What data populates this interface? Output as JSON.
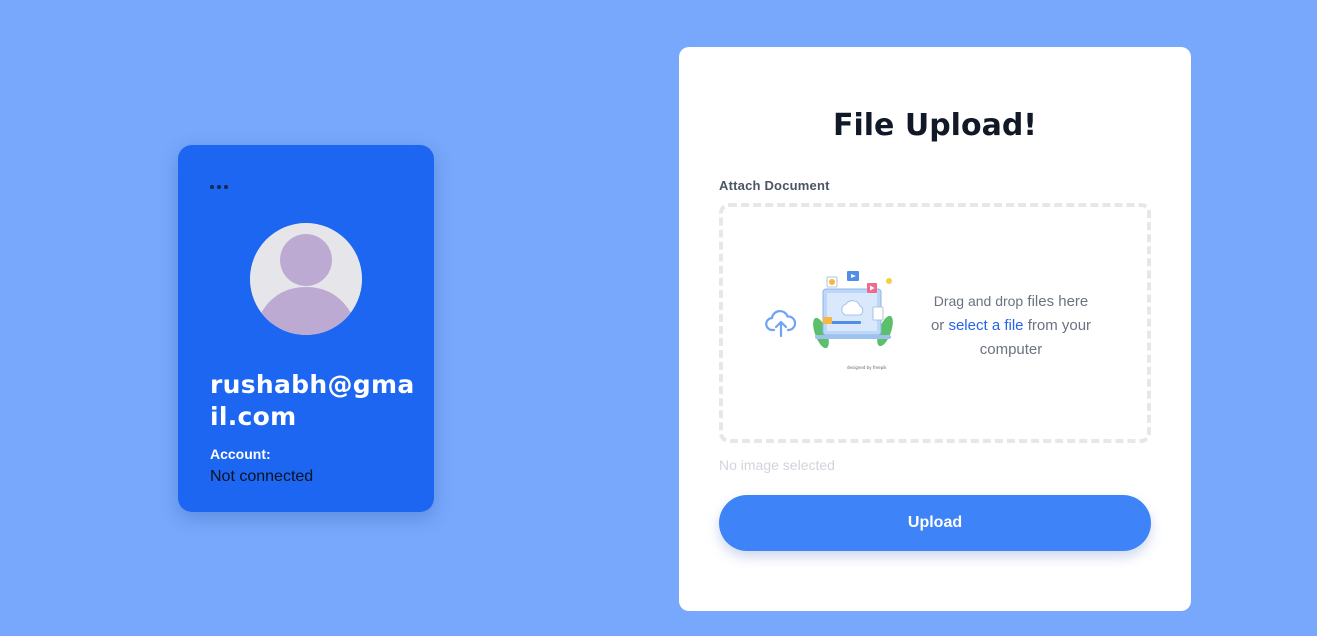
{
  "profile": {
    "email": "rushabh@gmail.com",
    "account_label": "Account:",
    "account_status": "Not connected",
    "menu_icon": "more-dots-icon",
    "avatar_icon": "user-avatar-icon"
  },
  "upload": {
    "title": "File Upload!",
    "attach_label": "Attach Document",
    "drop_text_part1": "Drag and drop",
    "drop_text_part2": "files here",
    "drop_text_or": "or",
    "select_link": "select a file",
    "drop_text_part3": "from your computer",
    "no_image_text": "No image selected",
    "button_label": "Upload",
    "upload_icon": "cloud-upload-icon"
  },
  "colors": {
    "background": "#77a8fb",
    "profile_card": "#1d66f1",
    "button": "#3f83f8",
    "link": "#2563eb"
  }
}
